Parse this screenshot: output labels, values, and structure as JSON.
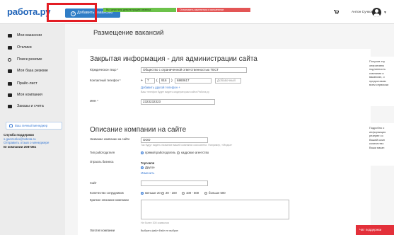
{
  "header": {
    "logo": "работа.ру",
    "add_vacancy": "Добавить вакансию",
    "notice_success": "Вы запустили демонстрацию сервиса",
    "notice_warning": "Остановить изменения и исполнение",
    "user_name": "Антон Сучков"
  },
  "sidebar": {
    "items": [
      {
        "label": "Мои вакансии",
        "icon": "briefcase-icon"
      },
      {
        "label": "Отклики",
        "icon": "document-icon"
      },
      {
        "label": "Поиск резюме",
        "icon": "search-icon"
      },
      {
        "label": "Моя база резюме",
        "icon": "folder-icon"
      },
      {
        "label": "Прайс-лист",
        "icon": "price-list-icon"
      },
      {
        "label": "Моя компания",
        "icon": "company-icon"
      },
      {
        "label": "Заказы и счета",
        "icon": "orders-icon"
      }
    ],
    "manager_button": "Ваш личный менеджер",
    "support_title": "Служба поддержки",
    "support_email": "s.ganzenko@rabota.ru",
    "support_link": "Отправить отзыв о менеджере",
    "company_id": "ID компании 2087361"
  },
  "main": {
    "page_title": "Размещение вакансий",
    "private_section": {
      "title": "Закрытая информация - для администрации сайта",
      "legal_label": "Юридическое лицо *",
      "legal_value": "Общество с ограниченной ответственностью ТЕСТ",
      "phone_label": "Контактный телефон *",
      "phone_plus": "+",
      "phone_country": "7",
      "phone_code": "916",
      "phone_number": "6860617",
      "phone_ext_placeholder": "Добавочный",
      "add_phone": "Добавить другой телефон +",
      "phone_hint": "Ваш телефон будет видеть модераторам сайта Работа.ру",
      "inn_label": "ИНН *",
      "inn_value": "2323232323"
    },
    "company_section": {
      "title": "Описание компании на сайте",
      "name_label": "Название компании на сайте",
      "name_value": "ООО",
      "name_hint": "Так будут видеть название вашей компании соискатели. Например, «Медиа»",
      "employer_type_label": "Тип работодателя",
      "employer_type_options": [
        "прямой работодатель",
        "кадровое агентство"
      ],
      "employer_type_selected": 0,
      "industry_label": "Отрасль бизнеса",
      "industry_head": "Торговля",
      "industry_value": "Другое",
      "industry_change": "Изменить",
      "site_label": "Сайт",
      "employees_label": "Количество сотрудников",
      "employees_options": [
        "меньше 20",
        "20 - 100",
        "100 - 500",
        "больше 500"
      ],
      "employees_selected": 0,
      "short_desc_label": "Краткое описание компании",
      "short_desc_hint": "Не более 300 символов",
      "logo_label": "Логотип компании",
      "logo_button": "Выбрать файл",
      "logo_file": "Файл не выбран"
    }
  },
  "tips": {
    "tip1": [
      "Получив эту",
      "оперативно",
      "подлинность",
      "компании и",
      "вакансию, о",
      "предоставим",
      "всем сервисам"
    ],
    "tip2": [
      "Подробно о",
      "информация",
      "резерве со",
      "Вашей комп",
      "количество",
      "Ваши вакан"
    ]
  },
  "chat": {
    "label": "Чат поддержки"
  },
  "colors": {
    "brand": "#1f63b8",
    "accent": "#2f7dc6",
    "success": "#6cc24a",
    "danger": "#e35555",
    "highlight": "#e31d24"
  }
}
